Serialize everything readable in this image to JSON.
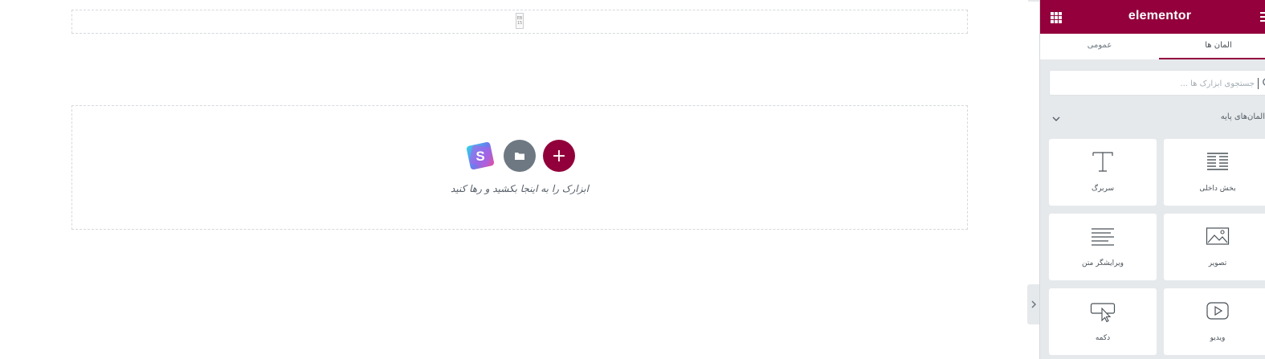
{
  "canvas": {
    "dropzone_text": "ابزارک را به اینجا بکشید و رها کنید",
    "add_button_glyph": "+",
    "spacer_glyph": "EB 15"
  },
  "panel": {
    "logo": "elementor",
    "tabs": {
      "elements": "المان ها",
      "general": "عمومی"
    },
    "search": {
      "placeholder": "جستجوی ابزارک ها ..."
    },
    "category": {
      "label": "المان‌های پایه"
    },
    "widgets": [
      {
        "label": "سربرگ",
        "icon": "heading-icon"
      },
      {
        "label": "بخش داخلی",
        "icon": "inner-section-icon"
      },
      {
        "label": "ویرایشگر متن",
        "icon": "text-editor-icon"
      },
      {
        "label": "تصویر",
        "icon": "image-icon"
      },
      {
        "label": "دکمه",
        "icon": "button-icon"
      },
      {
        "label": "ویدیو",
        "icon": "video-icon"
      }
    ]
  },
  "colors": {
    "brand": "#93003c",
    "folder_button": "#6d7882",
    "panel_bg": "#e6e9ec"
  }
}
